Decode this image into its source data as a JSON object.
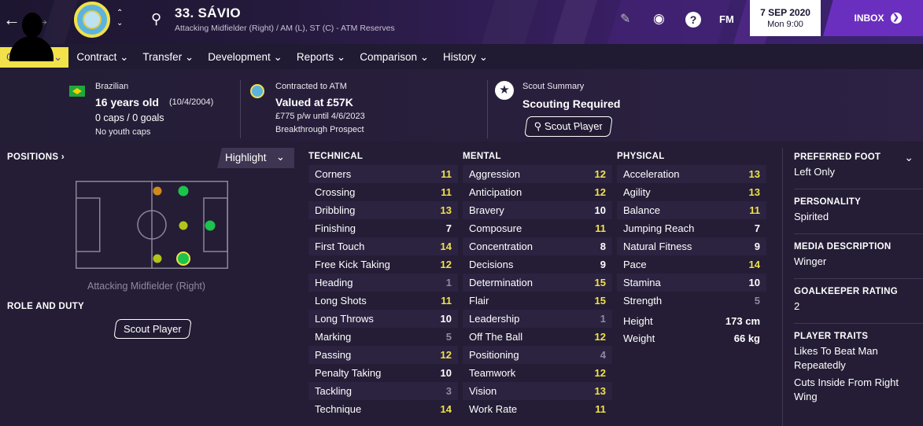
{
  "topbar": {
    "player_name": "33. SÁVIO",
    "subtitle": "Attacking Midfielder (Right) / AM (L), ST (C) - ATM Reserves",
    "fm_label": "FM",
    "date": "7 SEP 2020",
    "time": "Mon 9:00",
    "inbox_label": "INBOX",
    "help_label": "?"
  },
  "tabs": [
    {
      "label": "Overview ⌄"
    },
    {
      "label": "Contract ⌄"
    },
    {
      "label": "Transfer ⌄"
    },
    {
      "label": "Development ⌄"
    },
    {
      "label": "Reports ⌄"
    },
    {
      "label": "Comparison ⌄"
    },
    {
      "label": "History ⌄"
    }
  ],
  "info": {
    "nationality": "Brazilian",
    "age": "16 years old",
    "dob": "(10/4/2004)",
    "caps": "0 caps / 0 goals",
    "youth_caps": "No youth caps",
    "contract_label": "Contracted to ATM",
    "value": "Valued at £57K",
    "wage": "£775 p/w until 4/6/2023",
    "prospect": "Breakthrough Prospect",
    "scout_summary_label": "Scout Summary",
    "scouting_status": "Scouting Required",
    "scout_button": "Scout Player"
  },
  "positions": {
    "heading": "POSITIONS",
    "highlight_label": "Highlight",
    "position_text": "Attacking Midfielder (Right)",
    "role_heading": "ROLE AND DUTY",
    "scout_button": "Scout Player"
  },
  "technical": {
    "heading": "TECHNICAL",
    "attrs": [
      {
        "name": "Corners",
        "value": "11",
        "tier": "y"
      },
      {
        "name": "Crossing",
        "value": "11",
        "tier": "y"
      },
      {
        "name": "Dribbling",
        "value": "13",
        "tier": "y"
      },
      {
        "name": "Finishing",
        "value": "7",
        "tier": "w"
      },
      {
        "name": "First Touch",
        "value": "14",
        "tier": "y"
      },
      {
        "name": "Free Kick Taking",
        "value": "12",
        "tier": "y"
      },
      {
        "name": "Heading",
        "value": "1",
        "tier": "g"
      },
      {
        "name": "Long Shots",
        "value": "11",
        "tier": "y"
      },
      {
        "name": "Long Throws",
        "value": "10",
        "tier": "w"
      },
      {
        "name": "Marking",
        "value": "5",
        "tier": "g"
      },
      {
        "name": "Passing",
        "value": "12",
        "tier": "y"
      },
      {
        "name": "Penalty Taking",
        "value": "10",
        "tier": "w"
      },
      {
        "name": "Tackling",
        "value": "3",
        "tier": "g"
      },
      {
        "name": "Technique",
        "value": "14",
        "tier": "y"
      }
    ]
  },
  "mental": {
    "heading": "MENTAL",
    "attrs": [
      {
        "name": "Aggression",
        "value": "12",
        "tier": "y"
      },
      {
        "name": "Anticipation",
        "value": "12",
        "tier": "y"
      },
      {
        "name": "Bravery",
        "value": "10",
        "tier": "w"
      },
      {
        "name": "Composure",
        "value": "11",
        "tier": "y"
      },
      {
        "name": "Concentration",
        "value": "8",
        "tier": "w"
      },
      {
        "name": "Decisions",
        "value": "9",
        "tier": "w"
      },
      {
        "name": "Determination",
        "value": "15",
        "tier": "y"
      },
      {
        "name": "Flair",
        "value": "15",
        "tier": "y"
      },
      {
        "name": "Leadership",
        "value": "1",
        "tier": "g"
      },
      {
        "name": "Off The Ball",
        "value": "12",
        "tier": "y"
      },
      {
        "name": "Positioning",
        "value": "4",
        "tier": "g"
      },
      {
        "name": "Teamwork",
        "value": "12",
        "tier": "y"
      },
      {
        "name": "Vision",
        "value": "13",
        "tier": "y"
      },
      {
        "name": "Work Rate",
        "value": "11",
        "tier": "y"
      }
    ]
  },
  "physical": {
    "heading": "PHYSICAL",
    "attrs": [
      {
        "name": "Acceleration",
        "value": "13",
        "tier": "y"
      },
      {
        "name": "Agility",
        "value": "13",
        "tier": "y"
      },
      {
        "name": "Balance",
        "value": "11",
        "tier": "y"
      },
      {
        "name": "Jumping Reach",
        "value": "7",
        "tier": "w"
      },
      {
        "name": "Natural Fitness",
        "value": "9",
        "tier": "w"
      },
      {
        "name": "Pace",
        "value": "14",
        "tier": "y"
      },
      {
        "name": "Stamina",
        "value": "10",
        "tier": "w"
      },
      {
        "name": "Strength",
        "value": "5",
        "tier": "g"
      }
    ],
    "height_label": "Height",
    "height": "173 cm",
    "weight_label": "Weight",
    "weight": "66 kg"
  },
  "right": {
    "foot_label": "PREFERRED FOOT",
    "foot": "Left Only",
    "personality_label": "PERSONALITY",
    "personality": "Spirited",
    "media_label": "MEDIA DESCRIPTION",
    "media": "Winger",
    "gk_label": "GOALKEEPER RATING",
    "gk": "2",
    "traits_label": "PLAYER TRAITS",
    "traits": [
      "Likes To Beat Man Repeatedly",
      "Cuts Inside From Right Wing"
    ]
  },
  "colors": {
    "accent": "#f2e14a",
    "inbox": "#6b2fc0"
  }
}
